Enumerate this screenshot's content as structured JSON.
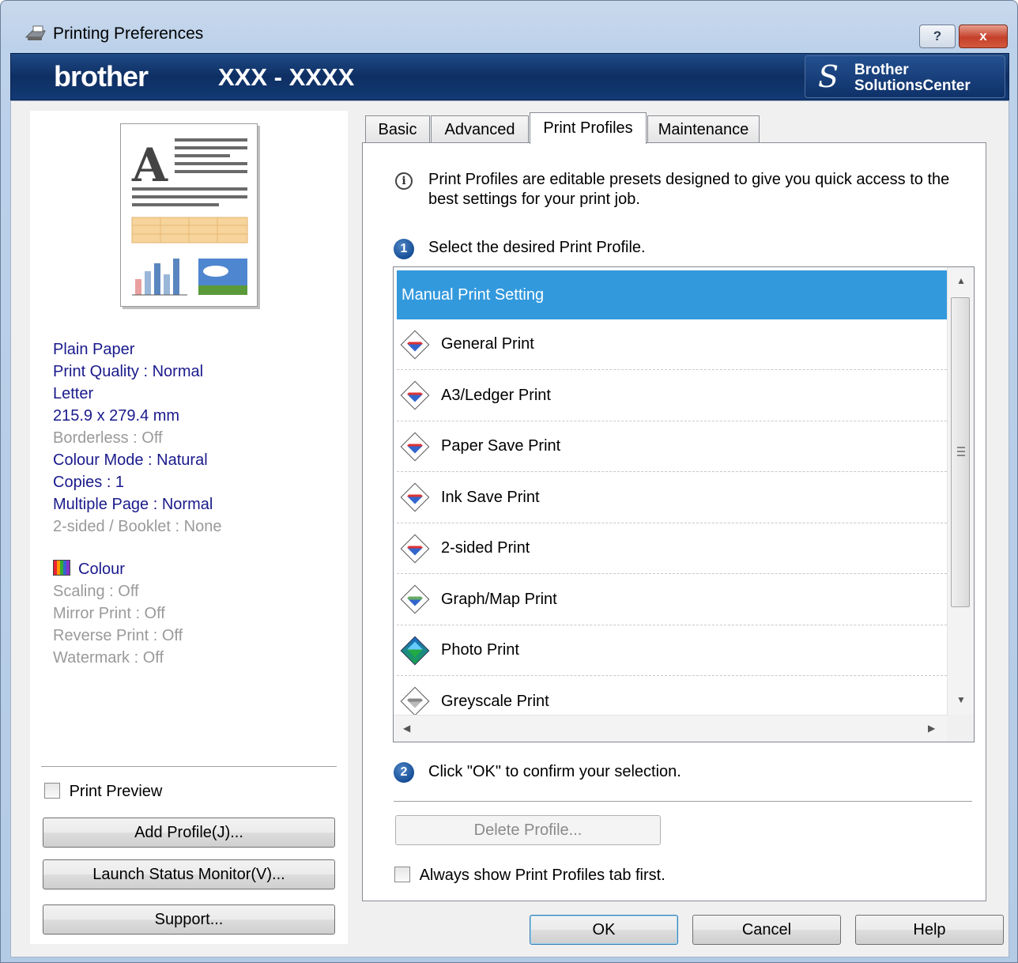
{
  "window": {
    "title": "Printing Preferences",
    "help_label": "?",
    "close_label": "x"
  },
  "banner": {
    "brand": "brother",
    "model": "XXX - XXXX",
    "solutions_line1": "Brother",
    "solutions_line2": "SolutionsCenter"
  },
  "summary": {
    "items": [
      {
        "text": "Plain Paper",
        "active": true
      },
      {
        "text": "Print Quality : Normal",
        "active": true
      },
      {
        "text": "Letter",
        "active": true
      },
      {
        "text": "215.9 x 279.4 mm",
        "active": true
      },
      {
        "text": "Borderless : Off",
        "active": false
      },
      {
        "text": "Colour Mode : Natural",
        "active": true
      },
      {
        "text": "Copies : 1",
        "active": true
      },
      {
        "text": "Multiple Page : Normal",
        "active": true
      },
      {
        "text": "2-sided / Booklet : None",
        "active": false
      }
    ],
    "colour_label": "Colour",
    "items2": [
      {
        "text": "Scaling : Off",
        "active": false
      },
      {
        "text": "Mirror Print : Off",
        "active": false
      },
      {
        "text": "Reverse Print : Off",
        "active": false
      },
      {
        "text": "Watermark : Off",
        "active": false
      }
    ]
  },
  "left_controls": {
    "print_preview_label": "Print Preview",
    "add_profile_label": "Add Profile(J)...",
    "launch_status_monitor_label": "Launch Status Monitor(V)...",
    "support_label": "Support..."
  },
  "tabs": [
    {
      "label": "Basic",
      "active": false
    },
    {
      "label": "Advanced",
      "active": false
    },
    {
      "label": "Print Profiles",
      "active": true
    },
    {
      "label": "Maintenance",
      "active": false
    }
  ],
  "profiles_tab": {
    "info_text": "Print Profiles are editable presets designed to give you quick access to the best settings for your print job.",
    "step1_number": "1",
    "step1_text": "Select the desired Print Profile.",
    "step2_number": "2",
    "step2_text": "Click \"OK\" to confirm your selection.",
    "profiles": [
      {
        "label": "Manual Print Setting",
        "icon": "none",
        "selected": true
      },
      {
        "label": "General Print",
        "icon": "general-print-icon",
        "selected": false
      },
      {
        "label": "A3/Ledger Print",
        "icon": "a3-ledger-print-icon",
        "selected": false
      },
      {
        "label": "Paper Save Print",
        "icon": "paper-save-print-icon",
        "selected": false
      },
      {
        "label": "Ink Save Print",
        "icon": "ink-save-print-icon",
        "selected": false
      },
      {
        "label": "2-sided Print",
        "icon": "two-sided-print-icon",
        "selected": false
      },
      {
        "label": "Graph/Map Print",
        "icon": "graph-map-print-icon",
        "selected": false
      },
      {
        "label": "Photo Print",
        "icon": "photo-print-icon",
        "selected": false
      },
      {
        "label": "Greyscale Print",
        "icon": "greyscale-print-icon",
        "selected": false
      }
    ],
    "delete_profile_label": "Delete Profile...",
    "always_show_label": "Always show Print Profiles tab first."
  },
  "footer": {
    "ok_label": "OK",
    "cancel_label": "Cancel",
    "help_label": "Help"
  },
  "colors": {
    "banner": "#0e2f63",
    "selection": "#3399dd",
    "summary_active": "#1a1a8c",
    "summary_inactive": "#9a9a9a"
  }
}
